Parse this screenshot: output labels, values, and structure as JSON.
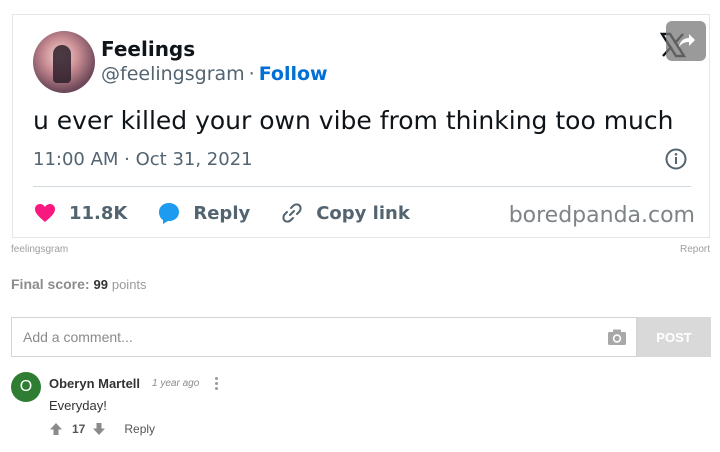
{
  "tweet": {
    "display_name": "Feelings",
    "handle": "@feelingsgram",
    "separator": "·",
    "follow_label": "Follow",
    "text": "u ever killed your own vibe from thinking too much",
    "timestamp": "11:00 AM · Oct 31, 2021",
    "likes": "11.8K",
    "reply_label": "Reply",
    "copy_link_label": "Copy link",
    "watermark": "boredpanda.com",
    "icons": [
      "x-logo-icon",
      "share-icon",
      "info-icon",
      "heart-icon",
      "reply-bubble-icon",
      "link-icon"
    ],
    "colors": {
      "heart": "#f91880",
      "reply": "#1d9bf0",
      "follow": "#006fd6"
    }
  },
  "source_credit": "feelingsgram",
  "report_label": "Report",
  "score": {
    "label": "Final score:",
    "value": "99",
    "unit": "points"
  },
  "comment_form": {
    "placeholder": "Add a comment...",
    "post_label": "POST"
  },
  "comments": [
    {
      "avatar_letter": "O",
      "author": "Oberyn Martell",
      "time": "1 year ago",
      "text": "Everyday!",
      "votes": "17",
      "reply_label": "Reply"
    }
  ]
}
